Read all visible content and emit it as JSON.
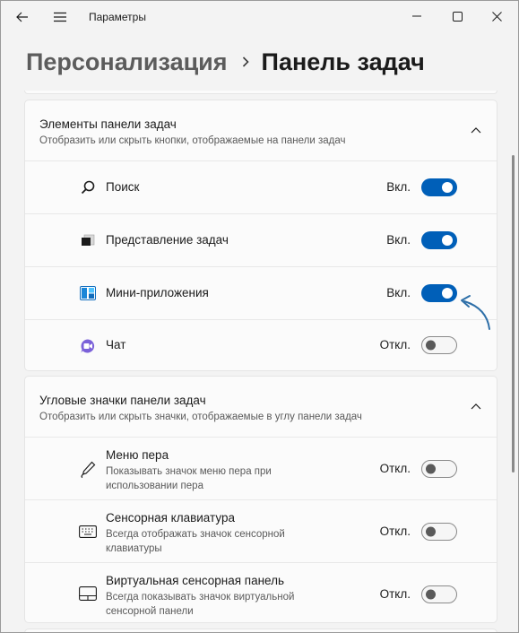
{
  "window": {
    "app_title": "Параметры",
    "back_icon": "arrow-left-icon",
    "menu_icon": "hamburger-icon",
    "controls": [
      "minimize-icon",
      "maximize-icon",
      "close-icon"
    ]
  },
  "breadcrumb": {
    "parent": "Персонализация",
    "separator_icon": "chevron-right-icon",
    "current": "Панель задач"
  },
  "sections": [
    {
      "title": "Элементы панели задач",
      "description": "Отобразить или скрыть кнопки, отображаемые на панели задач",
      "expanded": true,
      "items": [
        {
          "label": "Поиск",
          "icon": "search-icon",
          "state": "Вкл.",
          "on": true
        },
        {
          "label": "Представление задач",
          "icon": "task-view-icon",
          "state": "Вкл.",
          "on": true
        },
        {
          "label": "Мини-приложения",
          "icon": "widgets-icon",
          "state": "Вкл.",
          "on": true
        },
        {
          "label": "Чат",
          "icon": "chat-icon",
          "state": "Откл.",
          "on": false
        }
      ]
    },
    {
      "title": "Угловые значки панели задач",
      "description": "Отобразить или скрыть значки, отображаемые в углу панели задач",
      "expanded": true,
      "items": [
        {
          "label": "Меню пера",
          "sub": "Показывать значок меню пера при использовании пера",
          "icon": "pen-icon",
          "state": "Откл.",
          "on": false
        },
        {
          "label": "Сенсорная клавиатура",
          "sub": "Всегда отображать значок сенсорной клавиатуры",
          "icon": "keyboard-icon",
          "state": "Откл.",
          "on": false
        },
        {
          "label": "Виртуальная сенсорная панель",
          "sub": "Всегда показывать значок виртуальной сенсорной панели",
          "icon": "touchpad-icon",
          "state": "Откл.",
          "on": false
        }
      ]
    }
  ],
  "colors": {
    "accent": "#005fb8",
    "background": "#f3f3f3",
    "card": "#fbfbfb",
    "annotation_arrow": "#2e6fa8"
  }
}
